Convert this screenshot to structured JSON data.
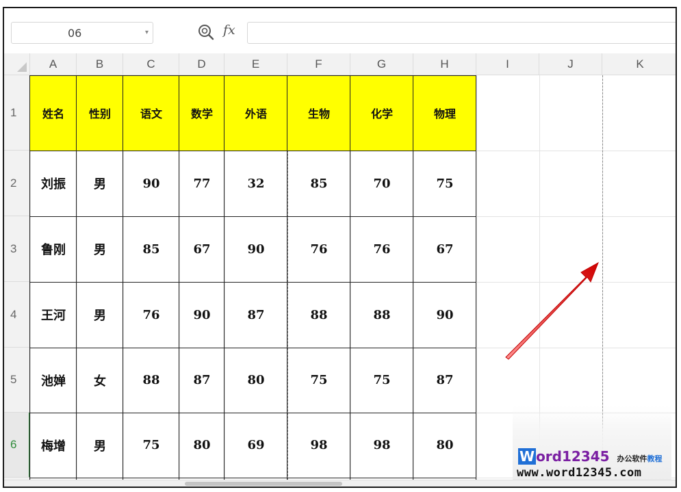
{
  "name_box": {
    "value": "06"
  },
  "formula_bar": {
    "fx_label": "fx",
    "value": ""
  },
  "columns": [
    "A",
    "B",
    "C",
    "D",
    "E",
    "F",
    "G",
    "H",
    "I",
    "J",
    "K"
  ],
  "rows": [
    "1",
    "2",
    "3",
    "4",
    "5",
    "6"
  ],
  "active_row": "6",
  "table": {
    "headers": [
      "姓名",
      "性别",
      "语文",
      "数学",
      "外语",
      "生物",
      "化学",
      "物理"
    ],
    "rows": [
      [
        "刘振",
        "男",
        "90",
        "77",
        "32",
        "85",
        "70",
        "75"
      ],
      [
        "鲁刚",
        "男",
        "85",
        "67",
        "90",
        "76",
        "76",
        "67"
      ],
      [
        "王河",
        "男",
        "76",
        "90",
        "87",
        "88",
        "88",
        "90"
      ],
      [
        "池婵",
        "女",
        "88",
        "87",
        "80",
        "75",
        "75",
        "87"
      ],
      [
        "梅增",
        "男",
        "75",
        "80",
        "69",
        "98",
        "98",
        "80"
      ]
    ]
  },
  "colors": {
    "header_fill": "#ffff00",
    "active_row": "#2e8b3a",
    "arrow": "#e01010"
  },
  "watermark": {
    "brand_w": "W",
    "brand_rest": "ord12345",
    "tag_a": "办公软件",
    "tag_b": "教程",
    "url": "www.word12345.com"
  }
}
